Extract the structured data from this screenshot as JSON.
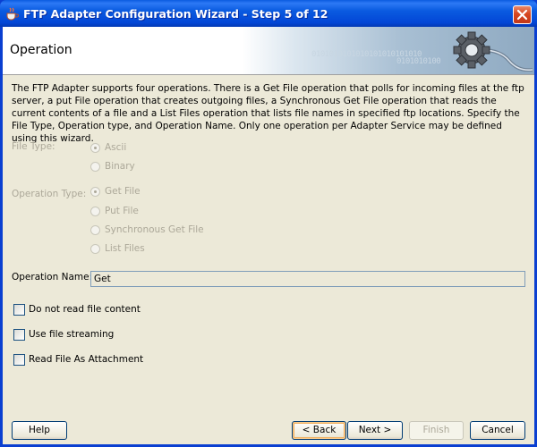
{
  "window": {
    "title": "FTP Adapter Configuration Wizard - Step 5 of 12"
  },
  "header": {
    "title": "Operation",
    "binary_deco": "0101010101010101010101010",
    "binary_deco2": "0101010100"
  },
  "description": "The FTP Adapter supports four operations.  There is a Get File operation that polls for incoming files at the ftp server, a put File operation that creates outgoing files, a Synchronous Get File operation that reads the current contents of a file and a List Files operation that lists file names in specified ftp locations.  Specify the File Type, Operation type, and Operation Name.  Only one operation per Adapter Service may be defined using this wizard.",
  "file_type": {
    "label": "File Type:",
    "options": [
      {
        "label": "Ascii",
        "checked": true
      },
      {
        "label": "Binary",
        "checked": false
      }
    ]
  },
  "operation_type": {
    "label": "Operation Type:",
    "options": [
      {
        "label": "Get File",
        "checked": true
      },
      {
        "label": "Put File",
        "checked": false
      },
      {
        "label": "Synchronous Get File",
        "checked": false
      },
      {
        "label": "List Files",
        "checked": false
      }
    ]
  },
  "operation_name": {
    "label": "Operation Name:",
    "value": "Get"
  },
  "options": {
    "do_not_read": "Do not read file content",
    "streaming": "Use file streaming",
    "attachment": "Read File As Attachment"
  },
  "buttons": {
    "help": "Help",
    "back": "< Back",
    "next": "Next >",
    "finish": "Finish",
    "cancel": "Cancel"
  },
  "colors": {
    "titlebar": "#0a5be0",
    "close": "#d7461f",
    "disabled_text": "#aca899"
  }
}
